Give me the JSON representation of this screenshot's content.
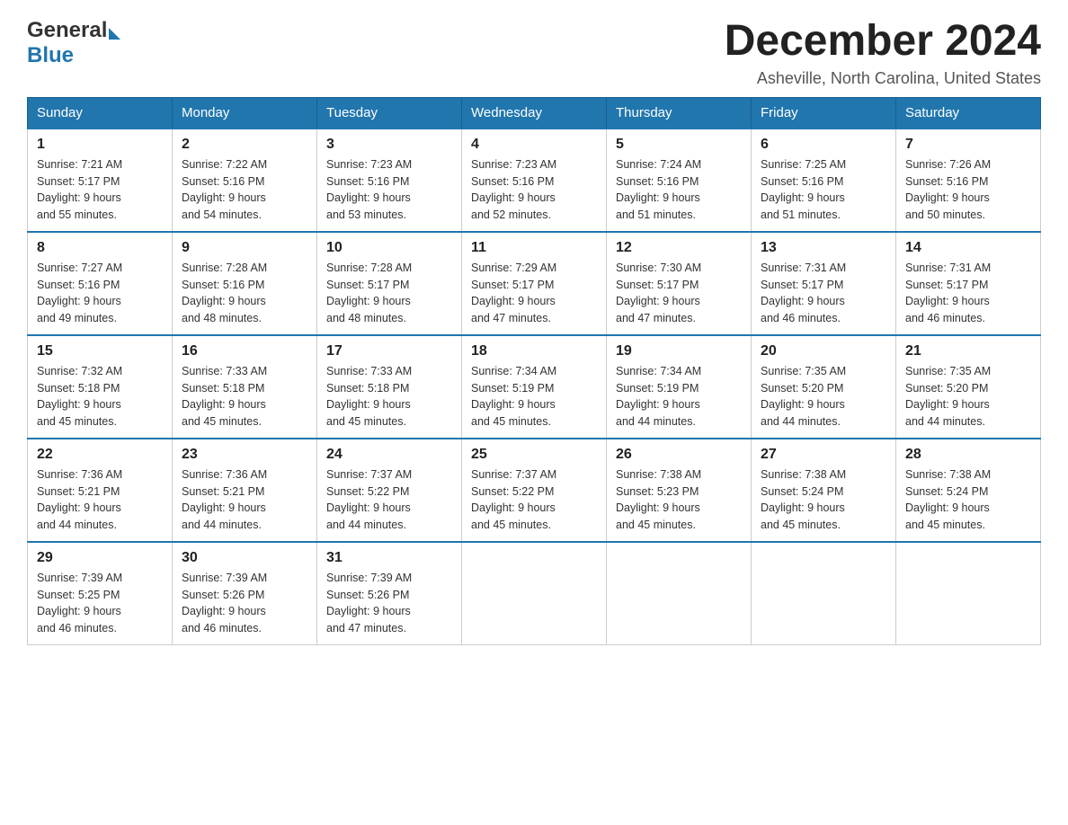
{
  "header": {
    "logo_general": "General",
    "logo_blue": "Blue",
    "month_title": "December 2024",
    "subtitle": "Asheville, North Carolina, United States"
  },
  "weekdays": [
    "Sunday",
    "Monday",
    "Tuesday",
    "Wednesday",
    "Thursday",
    "Friday",
    "Saturday"
  ],
  "weeks": [
    [
      {
        "day": "1",
        "sunrise": "7:21 AM",
        "sunset": "5:17 PM",
        "daylight": "9 hours and 55 minutes."
      },
      {
        "day": "2",
        "sunrise": "7:22 AM",
        "sunset": "5:16 PM",
        "daylight": "9 hours and 54 minutes."
      },
      {
        "day": "3",
        "sunrise": "7:23 AM",
        "sunset": "5:16 PM",
        "daylight": "9 hours and 53 minutes."
      },
      {
        "day": "4",
        "sunrise": "7:23 AM",
        "sunset": "5:16 PM",
        "daylight": "9 hours and 52 minutes."
      },
      {
        "day": "5",
        "sunrise": "7:24 AM",
        "sunset": "5:16 PM",
        "daylight": "9 hours and 51 minutes."
      },
      {
        "day": "6",
        "sunrise": "7:25 AM",
        "sunset": "5:16 PM",
        "daylight": "9 hours and 51 minutes."
      },
      {
        "day": "7",
        "sunrise": "7:26 AM",
        "sunset": "5:16 PM",
        "daylight": "9 hours and 50 minutes."
      }
    ],
    [
      {
        "day": "8",
        "sunrise": "7:27 AM",
        "sunset": "5:16 PM",
        "daylight": "9 hours and 49 minutes."
      },
      {
        "day": "9",
        "sunrise": "7:28 AM",
        "sunset": "5:16 PM",
        "daylight": "9 hours and 48 minutes."
      },
      {
        "day": "10",
        "sunrise": "7:28 AM",
        "sunset": "5:17 PM",
        "daylight": "9 hours and 48 minutes."
      },
      {
        "day": "11",
        "sunrise": "7:29 AM",
        "sunset": "5:17 PM",
        "daylight": "9 hours and 47 minutes."
      },
      {
        "day": "12",
        "sunrise": "7:30 AM",
        "sunset": "5:17 PM",
        "daylight": "9 hours and 47 minutes."
      },
      {
        "day": "13",
        "sunrise": "7:31 AM",
        "sunset": "5:17 PM",
        "daylight": "9 hours and 46 minutes."
      },
      {
        "day": "14",
        "sunrise": "7:31 AM",
        "sunset": "5:17 PM",
        "daylight": "9 hours and 46 minutes."
      }
    ],
    [
      {
        "day": "15",
        "sunrise": "7:32 AM",
        "sunset": "5:18 PM",
        "daylight": "9 hours and 45 minutes."
      },
      {
        "day": "16",
        "sunrise": "7:33 AM",
        "sunset": "5:18 PM",
        "daylight": "9 hours and 45 minutes."
      },
      {
        "day": "17",
        "sunrise": "7:33 AM",
        "sunset": "5:18 PM",
        "daylight": "9 hours and 45 minutes."
      },
      {
        "day": "18",
        "sunrise": "7:34 AM",
        "sunset": "5:19 PM",
        "daylight": "9 hours and 45 minutes."
      },
      {
        "day": "19",
        "sunrise": "7:34 AM",
        "sunset": "5:19 PM",
        "daylight": "9 hours and 44 minutes."
      },
      {
        "day": "20",
        "sunrise": "7:35 AM",
        "sunset": "5:20 PM",
        "daylight": "9 hours and 44 minutes."
      },
      {
        "day": "21",
        "sunrise": "7:35 AM",
        "sunset": "5:20 PM",
        "daylight": "9 hours and 44 minutes."
      }
    ],
    [
      {
        "day": "22",
        "sunrise": "7:36 AM",
        "sunset": "5:21 PM",
        "daylight": "9 hours and 44 minutes."
      },
      {
        "day": "23",
        "sunrise": "7:36 AM",
        "sunset": "5:21 PM",
        "daylight": "9 hours and 44 minutes."
      },
      {
        "day": "24",
        "sunrise": "7:37 AM",
        "sunset": "5:22 PM",
        "daylight": "9 hours and 44 minutes."
      },
      {
        "day": "25",
        "sunrise": "7:37 AM",
        "sunset": "5:22 PM",
        "daylight": "9 hours and 45 minutes."
      },
      {
        "day": "26",
        "sunrise": "7:38 AM",
        "sunset": "5:23 PM",
        "daylight": "9 hours and 45 minutes."
      },
      {
        "day": "27",
        "sunrise": "7:38 AM",
        "sunset": "5:24 PM",
        "daylight": "9 hours and 45 minutes."
      },
      {
        "day": "28",
        "sunrise": "7:38 AM",
        "sunset": "5:24 PM",
        "daylight": "9 hours and 45 minutes."
      }
    ],
    [
      {
        "day": "29",
        "sunrise": "7:39 AM",
        "sunset": "5:25 PM",
        "daylight": "9 hours and 46 minutes."
      },
      {
        "day": "30",
        "sunrise": "7:39 AM",
        "sunset": "5:26 PM",
        "daylight": "9 hours and 46 minutes."
      },
      {
        "day": "31",
        "sunrise": "7:39 AM",
        "sunset": "5:26 PM",
        "daylight": "9 hours and 47 minutes."
      },
      null,
      null,
      null,
      null
    ]
  ],
  "labels": {
    "sunrise": "Sunrise:",
    "sunset": "Sunset:",
    "daylight": "Daylight:"
  }
}
